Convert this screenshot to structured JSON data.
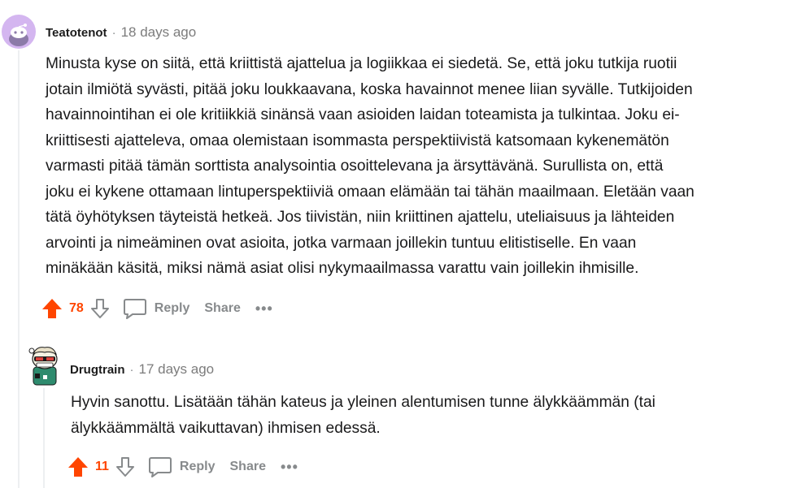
{
  "comments": [
    {
      "author": "Teatotenot",
      "separator": "·",
      "time": "18 days ago",
      "lines": [
        "Minusta kyse on siitä, että kriittistä ajattelua ja logiikkaa ei siedetä. Se, että joku tutkija ruotii",
        "jotain ilmiötä syvästi, pitää joku loukkaavana, koska havainnot menee liian syvälle. Tutkijoiden",
        "havainnointihan ei ole kritiikkiä sinänsä vaan asioiden laidan toteamista ja tulkintaa. Joku ei-",
        "kriittisesti ajatteleva, omaa olemistaan isommasta perspektiivistä katsomaan kykenemätön",
        "varmasti pitää tämän sorttista analysointia osoittelevana ja ärsyttävänä. Surullista on, että",
        "joku ei kykene ottamaan lintuperspektiiviä omaan elämään tai tähän maailmaan. Eletään vaan",
        "tätä öyhötyksen täyteistä hetkeä. Jos tiivistän, niin kriittinen ajattelu, uteliaisuus ja lähteiden",
        "arvointi ja nimeäminen ovat asioita, jotka varmaan joillekin tuntuu elitistiselle. En vaan",
        "minäkään käsitä, miksi nämä asiat olisi nykymaailmassa varattu vain joillekin ihmisille."
      ],
      "score": "78",
      "reply_label": "Reply",
      "share_label": "Share",
      "more_label": "•••",
      "avatar_icon": "reddit-default-avatar-icon"
    },
    {
      "author": "Drugtrain",
      "separator": "·",
      "time": "17 days ago",
      "lines": [
        "Hyvin sanottu. Lisätään tähän kateus ja yleinen alentumisen tunne älykkäämmän (tai",
        "älykkäämmältä vaikuttavan) ihmisen edessä."
      ],
      "score": "11",
      "reply_label": "Reply",
      "share_label": "Share",
      "more_label": "•••",
      "avatar_icon": "snoo-costume-avatar-icon"
    }
  ],
  "colors": {
    "upvote": "#ff4500",
    "muted": "#878a8c",
    "text": "#1a1a1b",
    "thread_line": "#edeff1",
    "avatar1_bg": "#d4b6f0"
  }
}
